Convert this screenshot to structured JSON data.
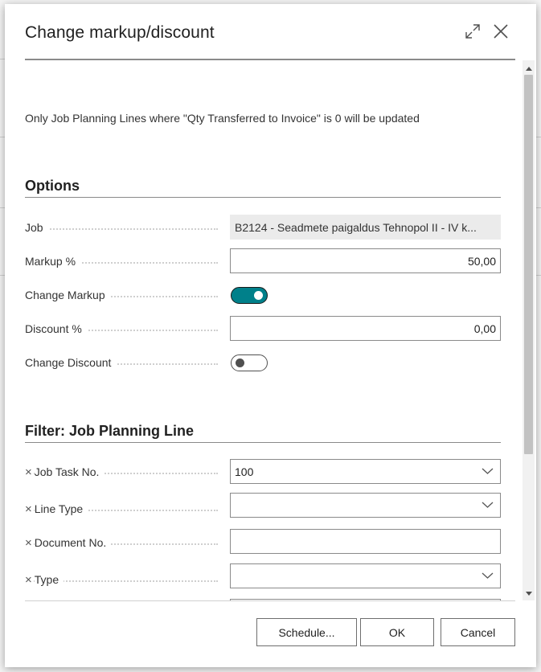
{
  "dialog": {
    "title": "Change markup/discount",
    "info": "Only Job Planning Lines where \"Qty Transferred to Invoice\" is 0 will be updated"
  },
  "options": {
    "title": "Options",
    "job": {
      "label": "Job",
      "value": "B2124 - Seadmete paigaldus Tehnopol II - IV k..."
    },
    "markup": {
      "label": "Markup %",
      "value": "50,00"
    },
    "change_markup": {
      "label": "Change Markup",
      "checked": true
    },
    "discount": {
      "label": "Discount %",
      "value": "0,00"
    },
    "change_discount": {
      "label": "Change Discount",
      "checked": false
    }
  },
  "filter": {
    "title": "Filter: Job Planning Line",
    "remove_glyph": "×",
    "job_task_no": {
      "label": "Job Task No.",
      "value": "100"
    },
    "line_type": {
      "label": "Line Type",
      "value": ""
    },
    "document_no": {
      "label": "Document No.",
      "value": ""
    },
    "type": {
      "label": "Type",
      "value": ""
    }
  },
  "footer": {
    "schedule_label": "Schedule...",
    "ok_label": "OK",
    "cancel_label": "Cancel"
  },
  "colors": {
    "accent": "#00808a"
  },
  "icons": {
    "expand": "expand-icon",
    "close": "close-icon",
    "dropdown": "chevron-down-icon"
  }
}
